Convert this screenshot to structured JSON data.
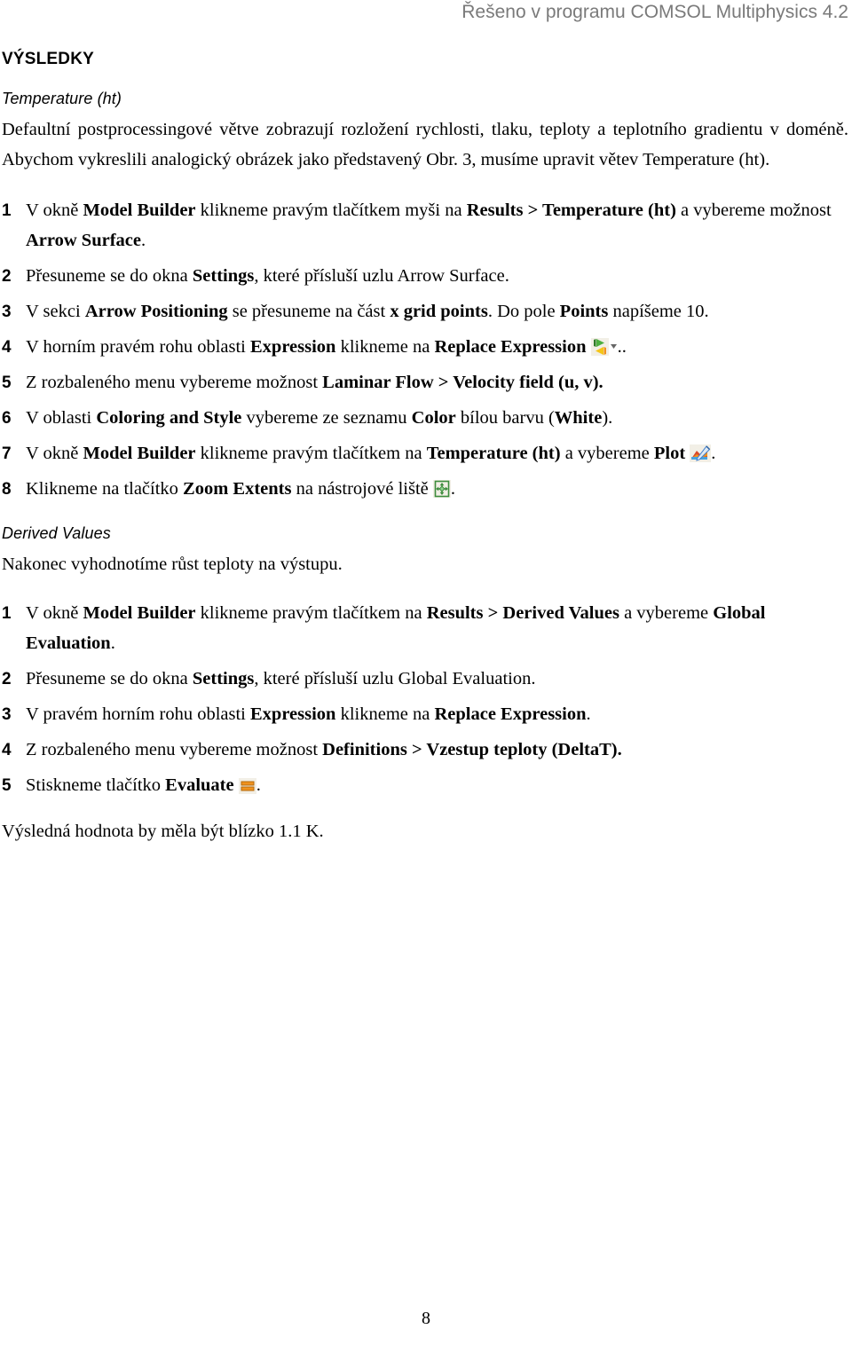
{
  "header": {
    "text": "Řešeno v programu COMSOL Multiphysics 4.2"
  },
  "section": {
    "title": "VÝSLEDKY"
  },
  "subsection1": {
    "title": "Temperature (ht)",
    "intro": "Defaultní postprocessingové větve zobrazují rozložení rychlosti, tlaku, teploty a teplotního gradientu v doméně. Abychom vykreslili analogický obrázek jako představený Obr. 3, musíme upravit větev Temperature (ht).",
    "steps": [
      {
        "num": "1",
        "parts": [
          {
            "t": "V okně ",
            "b": false
          },
          {
            "t": "Model Builder",
            "b": true
          },
          {
            "t": " klikneme pravým tlačítkem myši na ",
            "b": false
          },
          {
            "t": "Results > Temperature (ht)",
            "b": true
          },
          {
            "t": " a vybereme možnost ",
            "b": false
          },
          {
            "t": "Arrow Surface",
            "b": true
          },
          {
            "t": ".",
            "b": false
          }
        ]
      },
      {
        "num": "2",
        "parts": [
          {
            "t": "Přesuneme se do okna ",
            "b": false
          },
          {
            "t": "Settings",
            "b": true
          },
          {
            "t": ", které přísluší uzlu Arrow Surface.",
            "b": false
          }
        ]
      },
      {
        "num": "3",
        "parts": [
          {
            "t": "V sekci ",
            "b": false
          },
          {
            "t": "Arrow Positioning",
            "b": true
          },
          {
            "t": " se přesuneme na část ",
            "b": false
          },
          {
            "t": "x grid points",
            "b": true
          },
          {
            "t": ". Do pole ",
            "b": false
          },
          {
            "t": "Points",
            "b": true
          },
          {
            "t": " napíšeme 10.",
            "b": false
          }
        ]
      },
      {
        "num": "4",
        "icon": "replace-expression-icon",
        "parts": [
          {
            "t": "V horním pravém rohu oblasti ",
            "b": false
          },
          {
            "t": "Expression",
            "b": true
          },
          {
            "t": " klikneme na ",
            "b": false
          },
          {
            "t": "Replace Expression",
            "b": true
          },
          {
            "t": " ",
            "b": false
          }
        ],
        "tail": ".."
      },
      {
        "num": "5",
        "parts": [
          {
            "t": "Z rozbaleného menu vybereme možnost ",
            "b": false
          },
          {
            "t": "Laminar Flow > Velocity field (u, v).",
            "b": true
          }
        ]
      },
      {
        "num": "6",
        "parts": [
          {
            "t": "V oblasti ",
            "b": false
          },
          {
            "t": "Coloring and Style",
            "b": true
          },
          {
            "t": " vybereme ze seznamu ",
            "b": false
          },
          {
            "t": "Color",
            "b": true
          },
          {
            "t": " bílou barvu (",
            "b": false
          },
          {
            "t": "White",
            "b": true
          },
          {
            "t": ").",
            "b": false
          }
        ]
      },
      {
        "num": "7",
        "icon": "plot-icon",
        "parts": [
          {
            "t": "V okně ",
            "b": false
          },
          {
            "t": "Model Builder",
            "b": true
          },
          {
            "t": " klikneme pravým tlačítkem na ",
            "b": false
          },
          {
            "t": "Temperature (ht)",
            "b": true
          },
          {
            "t": " a vybereme ",
            "b": false
          },
          {
            "t": "Plot",
            "b": true
          },
          {
            "t": " ",
            "b": false
          }
        ],
        "tail": "."
      },
      {
        "num": "8",
        "icon": "zoom-extents-icon",
        "parts": [
          {
            "t": "Klikneme na tlačítko ",
            "b": false
          },
          {
            "t": "Zoom Extents",
            "b": true
          },
          {
            "t": " na nástrojové liště ",
            "b": false
          }
        ],
        "tail": "."
      }
    ]
  },
  "subsection2": {
    "title": "Derived Values",
    "intro": "Nakonec vyhodnotíme růst teploty na výstupu.",
    "steps": [
      {
        "num": "1",
        "parts": [
          {
            "t": "V okně ",
            "b": false
          },
          {
            "t": "Model Builder",
            "b": true
          },
          {
            "t": " klikneme pravým tlačítkem na ",
            "b": false
          },
          {
            "t": "Results > Derived Values",
            "b": true
          },
          {
            "t": " a vybereme ",
            "b": false
          },
          {
            "t": "Global Evaluation",
            "b": true
          },
          {
            "t": ".",
            "b": false
          }
        ]
      },
      {
        "num": "2",
        "parts": [
          {
            "t": "Přesuneme se do okna ",
            "b": false
          },
          {
            "t": "Settings",
            "b": true
          },
          {
            "t": ", které přísluší uzlu Global Evaluation.",
            "b": false
          }
        ]
      },
      {
        "num": "3",
        "parts": [
          {
            "t": "V pravém horním rohu oblasti ",
            "b": false
          },
          {
            "t": "Expression",
            "b": true
          },
          {
            "t": " klikneme na ",
            "b": false
          },
          {
            "t": "Replace Expression",
            "b": true
          },
          {
            "t": ".",
            "b": false
          }
        ]
      },
      {
        "num": "4",
        "parts": [
          {
            "t": "Z rozbaleného menu vybereme možnost ",
            "b": false
          },
          {
            "t": "Definitions > Vzestup teploty (DeltaT).",
            "b": true
          }
        ]
      },
      {
        "num": "5",
        "icon": "evaluate-icon",
        "parts": [
          {
            "t": "Stiskneme tlačítko ",
            "b": false
          },
          {
            "t": "Evaluate",
            "b": true
          },
          {
            "t": " ",
            "b": false
          }
        ],
        "tail": "."
      }
    ],
    "outro": "Výsledná hodnota by měla být blízko 1.1 K."
  },
  "footer": {
    "page_number": "8"
  },
  "colors": {
    "header_gray": "#7a7a7a",
    "icon_green": "#4caf3f",
    "icon_orange": "#f0921e",
    "icon_yellow": "#f5c518",
    "icon_blue": "#3f7fd0",
    "icon_red": "#d94a2a",
    "icon_bg": "#f2efe6"
  }
}
